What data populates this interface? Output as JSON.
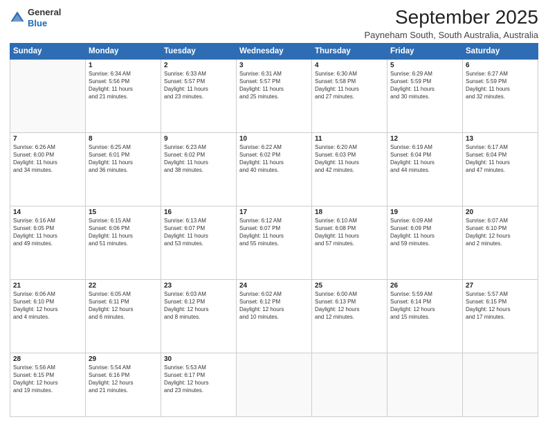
{
  "logo": {
    "general": "General",
    "blue": "Blue"
  },
  "header": {
    "month": "September 2025",
    "location": "Payneham South, South Australia, Australia"
  },
  "weekdays": [
    "Sunday",
    "Monday",
    "Tuesday",
    "Wednesday",
    "Thursday",
    "Friday",
    "Saturday"
  ],
  "weeks": [
    [
      {
        "day": "",
        "info": ""
      },
      {
        "day": "1",
        "info": "Sunrise: 6:34 AM\nSunset: 5:56 PM\nDaylight: 11 hours\nand 21 minutes."
      },
      {
        "day": "2",
        "info": "Sunrise: 6:33 AM\nSunset: 5:57 PM\nDaylight: 11 hours\nand 23 minutes."
      },
      {
        "day": "3",
        "info": "Sunrise: 6:31 AM\nSunset: 5:57 PM\nDaylight: 11 hours\nand 25 minutes."
      },
      {
        "day": "4",
        "info": "Sunrise: 6:30 AM\nSunset: 5:58 PM\nDaylight: 11 hours\nand 27 minutes."
      },
      {
        "day": "5",
        "info": "Sunrise: 6:29 AM\nSunset: 5:59 PM\nDaylight: 11 hours\nand 30 minutes."
      },
      {
        "day": "6",
        "info": "Sunrise: 6:27 AM\nSunset: 5:59 PM\nDaylight: 11 hours\nand 32 minutes."
      }
    ],
    [
      {
        "day": "7",
        "info": "Sunrise: 6:26 AM\nSunset: 6:00 PM\nDaylight: 11 hours\nand 34 minutes."
      },
      {
        "day": "8",
        "info": "Sunrise: 6:25 AM\nSunset: 6:01 PM\nDaylight: 11 hours\nand 36 minutes."
      },
      {
        "day": "9",
        "info": "Sunrise: 6:23 AM\nSunset: 6:02 PM\nDaylight: 11 hours\nand 38 minutes."
      },
      {
        "day": "10",
        "info": "Sunrise: 6:22 AM\nSunset: 6:02 PM\nDaylight: 11 hours\nand 40 minutes."
      },
      {
        "day": "11",
        "info": "Sunrise: 6:20 AM\nSunset: 6:03 PM\nDaylight: 11 hours\nand 42 minutes."
      },
      {
        "day": "12",
        "info": "Sunrise: 6:19 AM\nSunset: 6:04 PM\nDaylight: 11 hours\nand 44 minutes."
      },
      {
        "day": "13",
        "info": "Sunrise: 6:17 AM\nSunset: 6:04 PM\nDaylight: 11 hours\nand 47 minutes."
      }
    ],
    [
      {
        "day": "14",
        "info": "Sunrise: 6:16 AM\nSunset: 6:05 PM\nDaylight: 11 hours\nand 49 minutes."
      },
      {
        "day": "15",
        "info": "Sunrise: 6:15 AM\nSunset: 6:06 PM\nDaylight: 11 hours\nand 51 minutes."
      },
      {
        "day": "16",
        "info": "Sunrise: 6:13 AM\nSunset: 6:07 PM\nDaylight: 11 hours\nand 53 minutes."
      },
      {
        "day": "17",
        "info": "Sunrise: 6:12 AM\nSunset: 6:07 PM\nDaylight: 11 hours\nand 55 minutes."
      },
      {
        "day": "18",
        "info": "Sunrise: 6:10 AM\nSunset: 6:08 PM\nDaylight: 11 hours\nand 57 minutes."
      },
      {
        "day": "19",
        "info": "Sunrise: 6:09 AM\nSunset: 6:09 PM\nDaylight: 11 hours\nand 59 minutes."
      },
      {
        "day": "20",
        "info": "Sunrise: 6:07 AM\nSunset: 6:10 PM\nDaylight: 12 hours\nand 2 minutes."
      }
    ],
    [
      {
        "day": "21",
        "info": "Sunrise: 6:06 AM\nSunset: 6:10 PM\nDaylight: 12 hours\nand 4 minutes."
      },
      {
        "day": "22",
        "info": "Sunrise: 6:05 AM\nSunset: 6:11 PM\nDaylight: 12 hours\nand 6 minutes."
      },
      {
        "day": "23",
        "info": "Sunrise: 6:03 AM\nSunset: 6:12 PM\nDaylight: 12 hours\nand 8 minutes."
      },
      {
        "day": "24",
        "info": "Sunrise: 6:02 AM\nSunset: 6:12 PM\nDaylight: 12 hours\nand 10 minutes."
      },
      {
        "day": "25",
        "info": "Sunrise: 6:00 AM\nSunset: 6:13 PM\nDaylight: 12 hours\nand 12 minutes."
      },
      {
        "day": "26",
        "info": "Sunrise: 5:59 AM\nSunset: 6:14 PM\nDaylight: 12 hours\nand 15 minutes."
      },
      {
        "day": "27",
        "info": "Sunrise: 5:57 AM\nSunset: 6:15 PM\nDaylight: 12 hours\nand 17 minutes."
      }
    ],
    [
      {
        "day": "28",
        "info": "Sunrise: 5:56 AM\nSunset: 6:15 PM\nDaylight: 12 hours\nand 19 minutes."
      },
      {
        "day": "29",
        "info": "Sunrise: 5:54 AM\nSunset: 6:16 PM\nDaylight: 12 hours\nand 21 minutes."
      },
      {
        "day": "30",
        "info": "Sunrise: 5:53 AM\nSunset: 6:17 PM\nDaylight: 12 hours\nand 23 minutes."
      },
      {
        "day": "",
        "info": ""
      },
      {
        "day": "",
        "info": ""
      },
      {
        "day": "",
        "info": ""
      },
      {
        "day": "",
        "info": ""
      }
    ]
  ]
}
